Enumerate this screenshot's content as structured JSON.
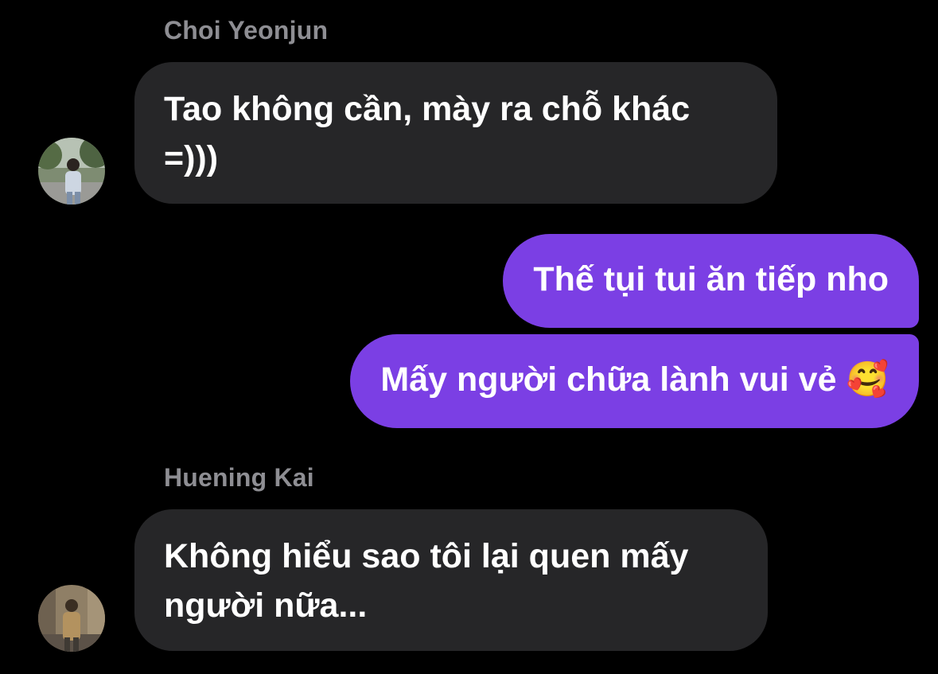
{
  "messages": [
    {
      "sender": "Choi Yeonjun",
      "text": "Tao không cần, mày ra chỗ khác\n=)))",
      "direction": "incoming",
      "avatar_icon": "user-avatar-photo"
    },
    {
      "text": "Thế tụi tui ăn tiếp nho",
      "direction": "outgoing"
    },
    {
      "text": "Mấy người chữa lành vui vẻ 🥰",
      "direction": "outgoing"
    },
    {
      "sender": "Huening Kai",
      "text": "Không hiểu sao tôi lại quen mấy\nngười nữa...",
      "direction": "incoming",
      "avatar_icon": "user-avatar-photo"
    }
  ],
  "colors": {
    "background": "#000000",
    "incoming_bubble": "#262628",
    "outgoing_bubble": "#7b3fe4",
    "sender_name": "#8e8e93",
    "text": "#ffffff"
  }
}
